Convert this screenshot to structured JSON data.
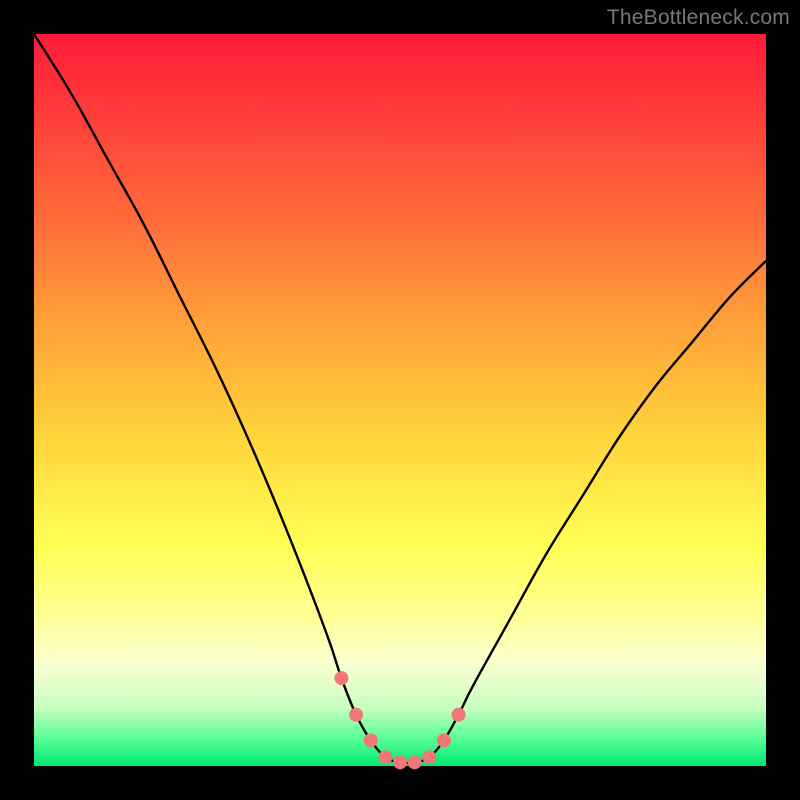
{
  "watermark": "TheBottleneck.com",
  "colors": {
    "page_bg": "#000000",
    "curve_stroke": "#000000",
    "marker_fill": "#f07878",
    "marker_stroke": "#d85a5a"
  },
  "chart_data": {
    "type": "line",
    "title": "",
    "xlabel": "",
    "ylabel": "",
    "xlim": [
      0,
      100
    ],
    "ylim": [
      0,
      100
    ],
    "grid": false,
    "legend": false,
    "series": [
      {
        "name": "bottleneck-curve",
        "x": [
          0,
          5,
          10,
          15,
          20,
          25,
          30,
          35,
          40,
          42,
          44,
          46,
          48,
          50,
          52,
          54,
          56,
          58,
          60,
          65,
          70,
          75,
          80,
          85,
          90,
          95,
          100
        ],
        "y": [
          100,
          92,
          83,
          74,
          64,
          54,
          43,
          31,
          18,
          12,
          7,
          3.5,
          1.2,
          0.5,
          0.5,
          1.2,
          3.5,
          7,
          11,
          20,
          29,
          37,
          45,
          52,
          58,
          64,
          69
        ]
      }
    ],
    "markers": {
      "series": "bottleneck-curve",
      "points": [
        {
          "x": 42,
          "y": 12
        },
        {
          "x": 44,
          "y": 7
        },
        {
          "x": 46,
          "y": 3.5
        },
        {
          "x": 48,
          "y": 1.2
        },
        {
          "x": 50,
          "y": 0.5
        },
        {
          "x": 52,
          "y": 0.5
        },
        {
          "x": 54,
          "y": 1.2
        },
        {
          "x": 56,
          "y": 3.5
        },
        {
          "x": 58,
          "y": 7
        }
      ],
      "radius_px": 7
    }
  }
}
